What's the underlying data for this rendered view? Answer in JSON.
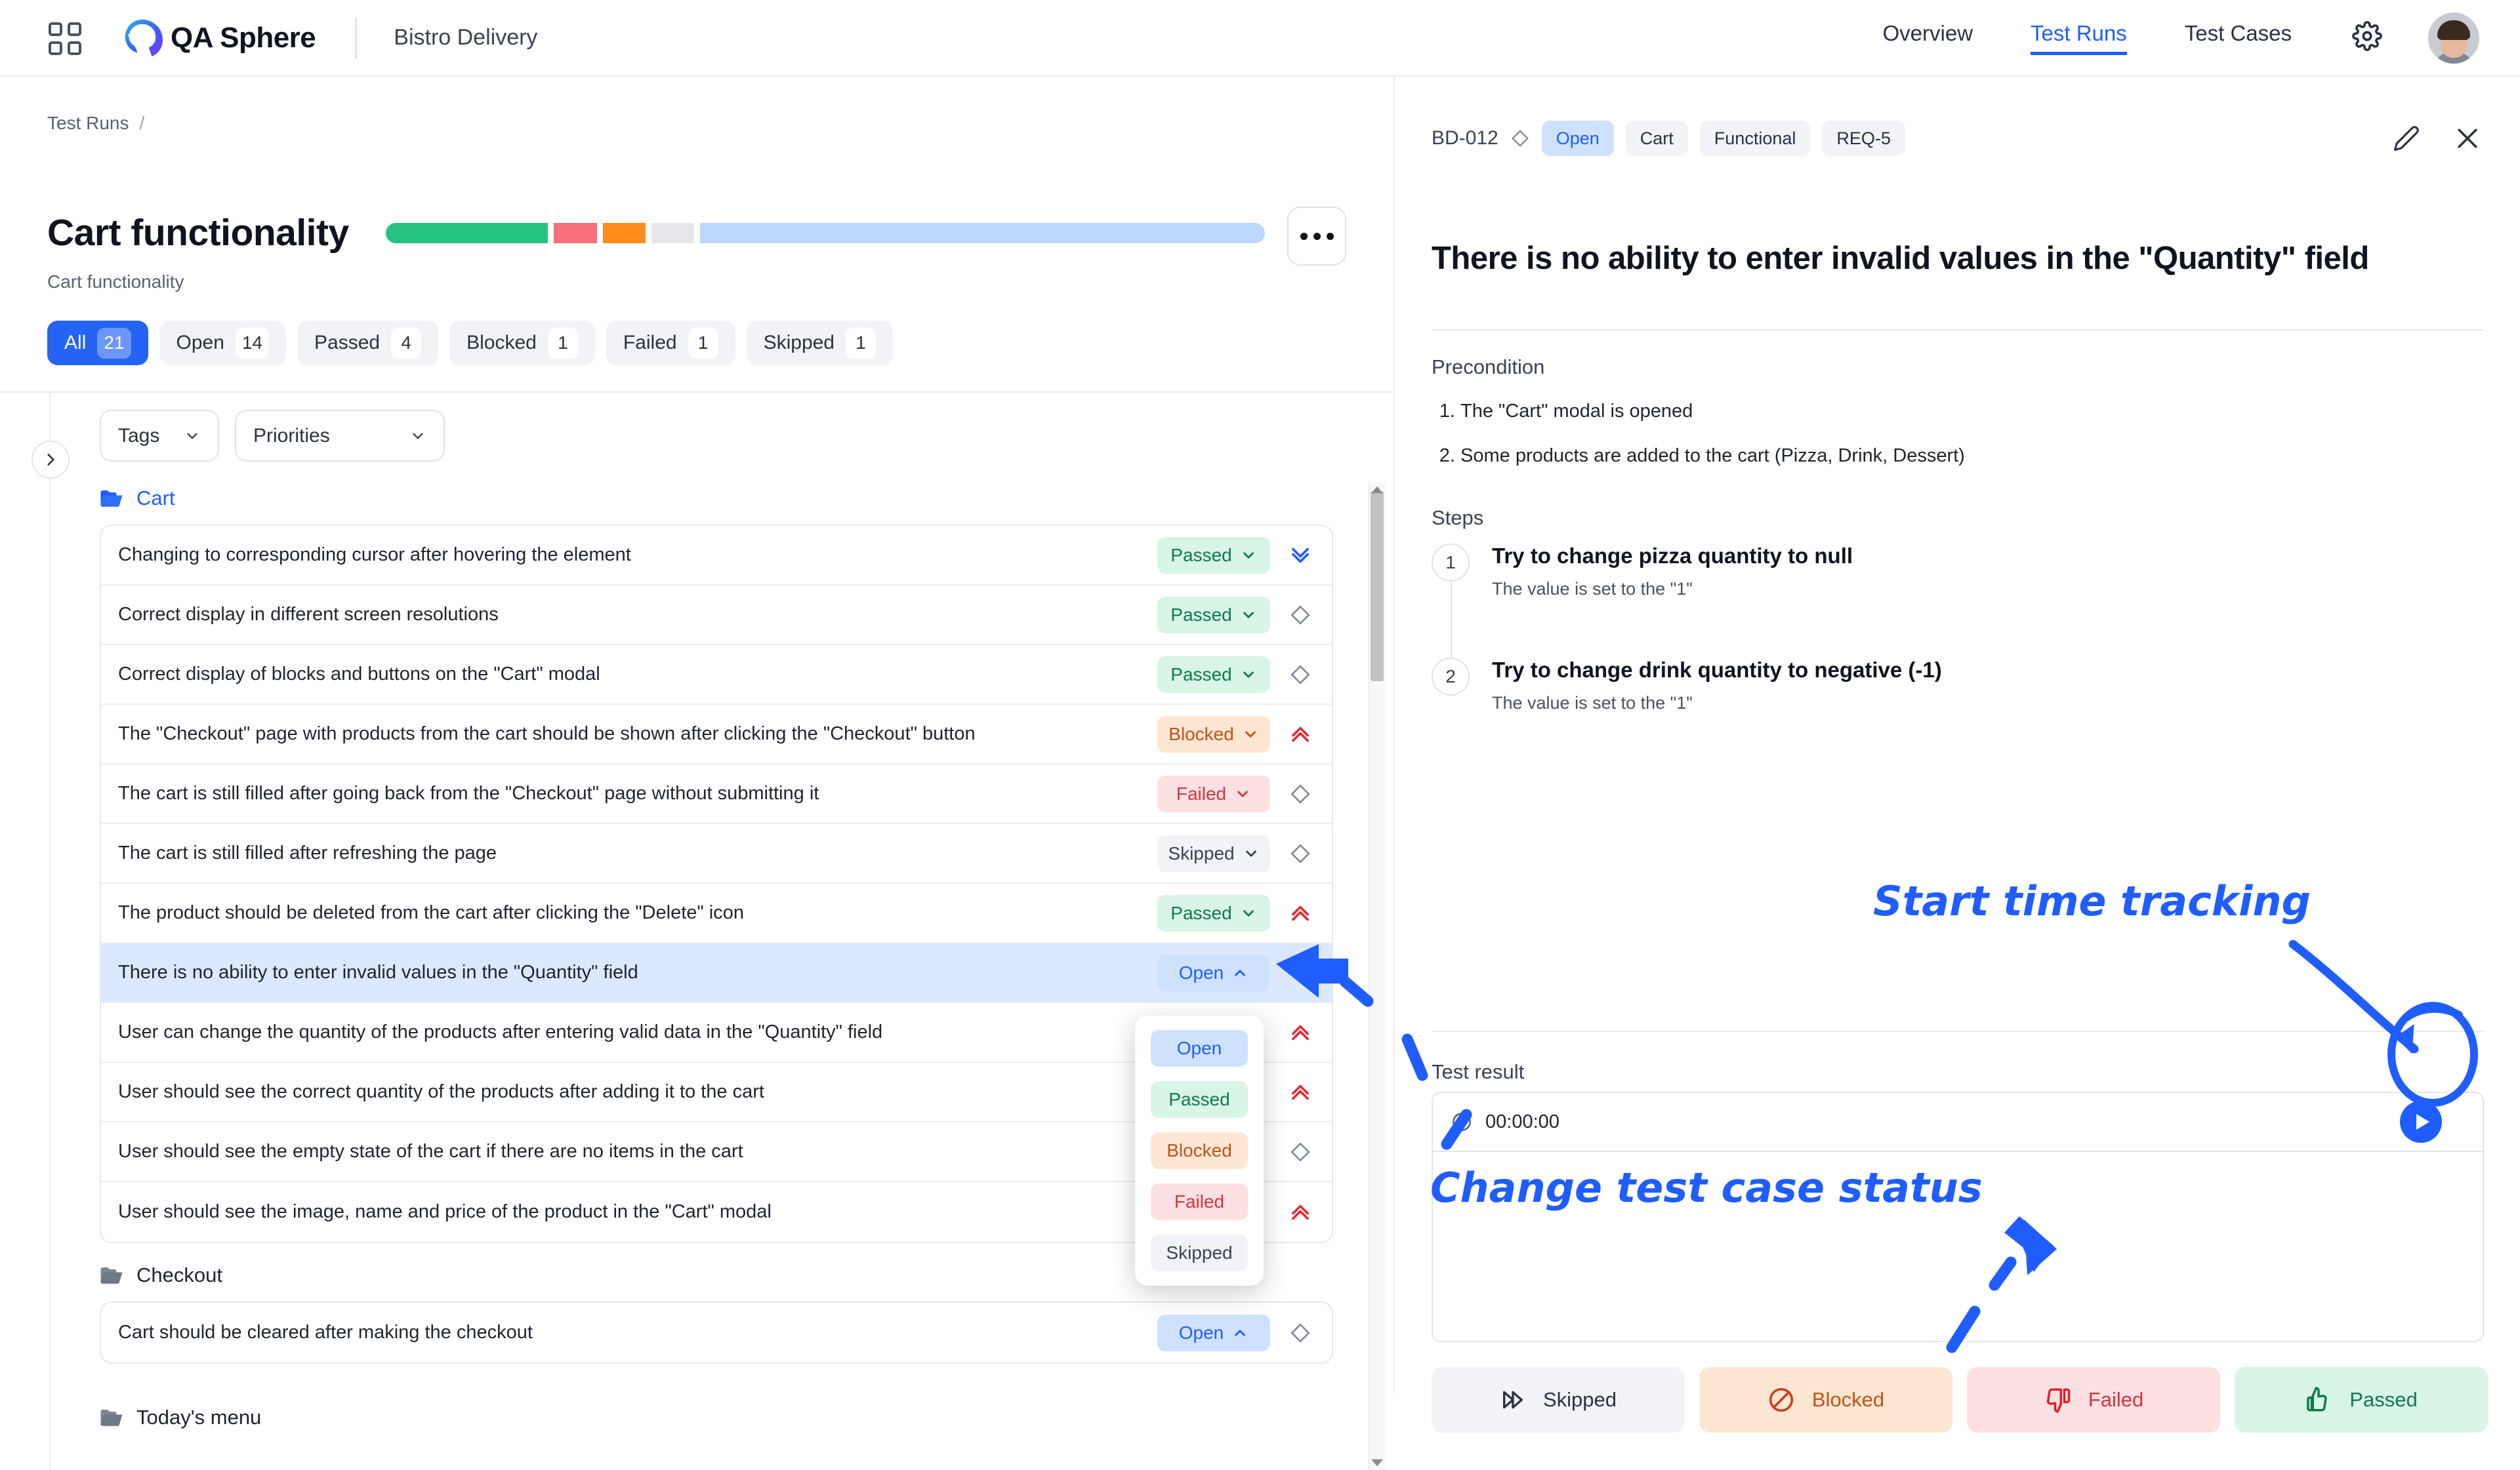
{
  "app": {
    "brand": "QA Sphere",
    "project": "Bistro Delivery"
  },
  "topnav": {
    "items": [
      {
        "label": "Overview",
        "active": false
      },
      {
        "label": "Test Runs",
        "active": true
      },
      {
        "label": "Test Cases",
        "active": false
      }
    ]
  },
  "breadcrumb": {
    "root": "Test Runs",
    "separator": "/"
  },
  "run": {
    "title": "Cart functionality",
    "subtitle": "Cart functionality",
    "progress": [
      {
        "name": "Passed",
        "color": "#26c281",
        "percent": 19.0
      },
      {
        "name": "Failed",
        "color": "#f8707a",
        "percent": 5.0
      },
      {
        "name": "Blocked",
        "color": "#ff8c1a",
        "percent": 5.0
      },
      {
        "name": "Skipped",
        "color": "#e6e8ec",
        "percent": 5.0
      },
      {
        "name": "Open",
        "color": "#bcd8fb",
        "percent": 66.0
      }
    ]
  },
  "filters": {
    "tabs": [
      {
        "label": "All",
        "count": "21",
        "active": true
      },
      {
        "label": "Open",
        "count": "14",
        "active": false
      },
      {
        "label": "Passed",
        "count": "4",
        "active": false
      },
      {
        "label": "Blocked",
        "count": "1",
        "active": false
      },
      {
        "label": "Failed",
        "count": "1",
        "active": false
      },
      {
        "label": "Skipped",
        "count": "1",
        "active": false
      }
    ]
  },
  "list_toolbar": {
    "tags_label": "Tags",
    "priorities_label": "Priorities"
  },
  "groups": [
    {
      "name": "Cart",
      "highlighted": true
    },
    {
      "name": "Checkout",
      "highlighted": false
    },
    {
      "name": "Today's menu",
      "highlighted": false
    }
  ],
  "cart_rows": [
    {
      "title": "Changing to corresponding cursor after hovering the element",
      "status": "Passed",
      "status_class": "b-passed",
      "priority": "low",
      "selected": false
    },
    {
      "title": "Correct display in different screen resolutions",
      "status": "Passed",
      "status_class": "b-passed",
      "priority": "medium",
      "selected": false
    },
    {
      "title": "Correct display of blocks and buttons on the \"Cart\" modal",
      "status": "Passed",
      "status_class": "b-passed",
      "priority": "medium",
      "selected": false
    },
    {
      "title": "The \"Checkout\" page with products from the cart should be shown after clicking the \"Checkout\" button",
      "status": "Blocked",
      "status_class": "b-blocked",
      "priority": "high",
      "selected": false
    },
    {
      "title": "The cart is still filled after going back from the \"Checkout\" page without submitting it",
      "status": "Failed",
      "status_class": "b-failed",
      "priority": "medium",
      "selected": false
    },
    {
      "title": "The cart is still filled after refreshing the page",
      "status": "Skipped",
      "status_class": "b-skipped",
      "priority": "medium",
      "selected": false
    },
    {
      "title": "The product should be deleted from the cart after clicking the \"Delete\" icon",
      "status": "Passed",
      "status_class": "b-passed",
      "priority": "high",
      "selected": false
    },
    {
      "title": "There is no ability to enter invalid values in the \"Quantity\" field",
      "status": "Open",
      "status_class": "b-open",
      "priority": "medium",
      "selected": true
    },
    {
      "title": "User can change the quantity of the products after entering valid data in the \"Quantity\" field",
      "status": "",
      "status_class": "",
      "priority": "high",
      "selected": false
    },
    {
      "title": "User should see the correct quantity of the products after adding it to the cart",
      "status": "",
      "status_class": "",
      "priority": "high",
      "selected": false
    },
    {
      "title": "User should see the empty state of the cart if there are no items in the cart",
      "status": "",
      "status_class": "",
      "priority": "medium",
      "selected": false
    },
    {
      "title": "User should see the image, name and price of the product in the \"Cart\" modal",
      "status": "",
      "status_class": "",
      "priority": "high",
      "selected": false
    }
  ],
  "checkout_rows": [
    {
      "title": "Cart should be cleared after making the checkout",
      "status": "Open",
      "status_class": "b-open",
      "priority": "medium",
      "selected": false
    }
  ],
  "status_dropdown": {
    "open": true,
    "options": [
      {
        "label": "Open",
        "class": "b-open-plain"
      },
      {
        "label": "Passed",
        "class": "b-passed"
      },
      {
        "label": "Blocked",
        "class": "b-blocked"
      },
      {
        "label": "Failed",
        "class": "b-failed"
      },
      {
        "label": "Skipped",
        "class": "b-skipped"
      }
    ]
  },
  "detail": {
    "id": "BD-012",
    "status_tag": "Open",
    "tags": [
      "Cart",
      "Functional",
      "REQ-5"
    ],
    "title": "There is no ability to enter invalid values in the \"Quantity\" field",
    "precondition_label": "Precondition",
    "preconditions": [
      "The \"Cart\" modal is opened",
      "Some products are added to the cart (Pizza, Drink, Dessert)"
    ],
    "steps_label": "Steps",
    "steps": [
      {
        "n": "1",
        "title": "Try to change pizza quantity to null",
        "desc": "The value is set to the \"1\""
      },
      {
        "n": "2",
        "title": "Try to change drink quantity to negative (-1)",
        "desc": "The value is set to the \"1\""
      }
    ],
    "result_label": "Test result",
    "timer": "00:00:00",
    "status_buttons": [
      {
        "label": "Skipped",
        "class": "sb-skipped",
        "icon": "skip-forward-icon"
      },
      {
        "label": "Blocked",
        "class": "sb-blocked",
        "icon": "block-icon"
      },
      {
        "label": "Failed",
        "class": "sb-failed",
        "icon": "thumbs-down-icon"
      },
      {
        "label": "Passed",
        "class": "sb-passed",
        "icon": "thumbs-up-icon"
      }
    ]
  },
  "annotations": [
    {
      "text": "Start time tracking",
      "color": "#1f5dff"
    },
    {
      "text": "Change test case status",
      "color": "#1f5dff"
    }
  ],
  "colors": {
    "accent": "#1f5dff",
    "passed": "#0f7b4a",
    "failed": "#d23540",
    "blocked": "#c3521a",
    "skipped": "#3b4252",
    "open": "#1f5dff"
  }
}
